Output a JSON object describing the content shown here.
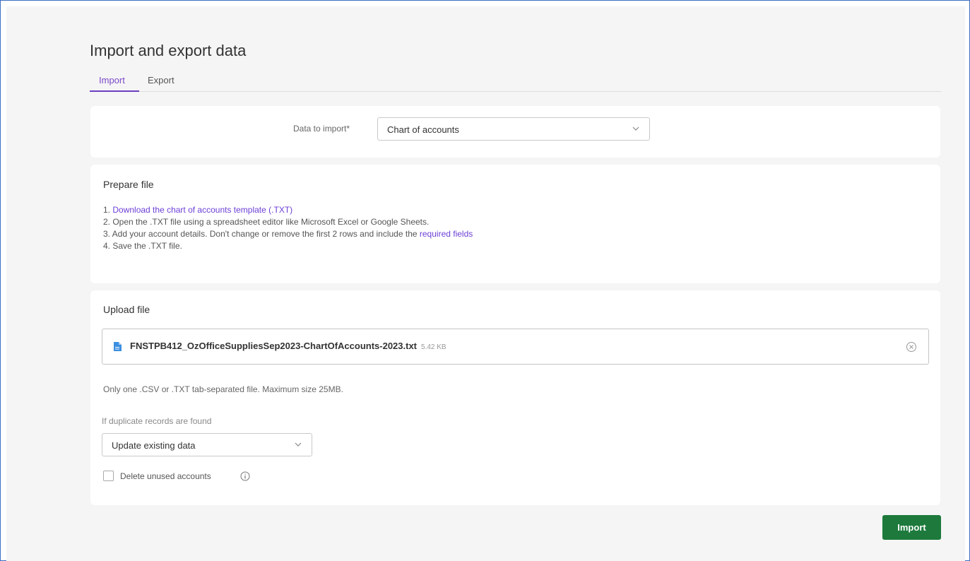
{
  "page": {
    "title": "Import and export data"
  },
  "tabs": [
    {
      "label": "Import",
      "active": true
    },
    {
      "label": "Export",
      "active": false
    }
  ],
  "data_to_import": {
    "label": "Data to import*",
    "value": "Chart of accounts"
  },
  "prepare": {
    "title": "Prepare file",
    "step1_prefix": "1.",
    "step1_link": "Download the chart of accounts template (.TXT)",
    "step2": "2. Open the .TXT file using a spreadsheet editor like Microsoft Excel or Google Sheets.",
    "step3_prefix": "3. Add your account details. Don't change or remove the first 2 rows and include the",
    "step3_link": "required fields",
    "step4": "4. Save the .TXT file."
  },
  "upload": {
    "title": "Upload file",
    "file_name": "FNSTPB412_OzOfficeSuppliesSep2023-ChartOfAccounts-2023.txt",
    "file_size": "5.42 KB",
    "note": "Only one .CSV or .TXT tab-separated file. Maximum size 25MB.",
    "duplicate_label": "If duplicate records are found",
    "duplicate_value": "Update existing data",
    "delete_label": "Delete unused accounts"
  },
  "actions": {
    "import_label": "Import"
  },
  "colors": {
    "accent": "#6b3fc0",
    "primary_button": "#1d7a3c",
    "link": "#6c3fd6"
  }
}
